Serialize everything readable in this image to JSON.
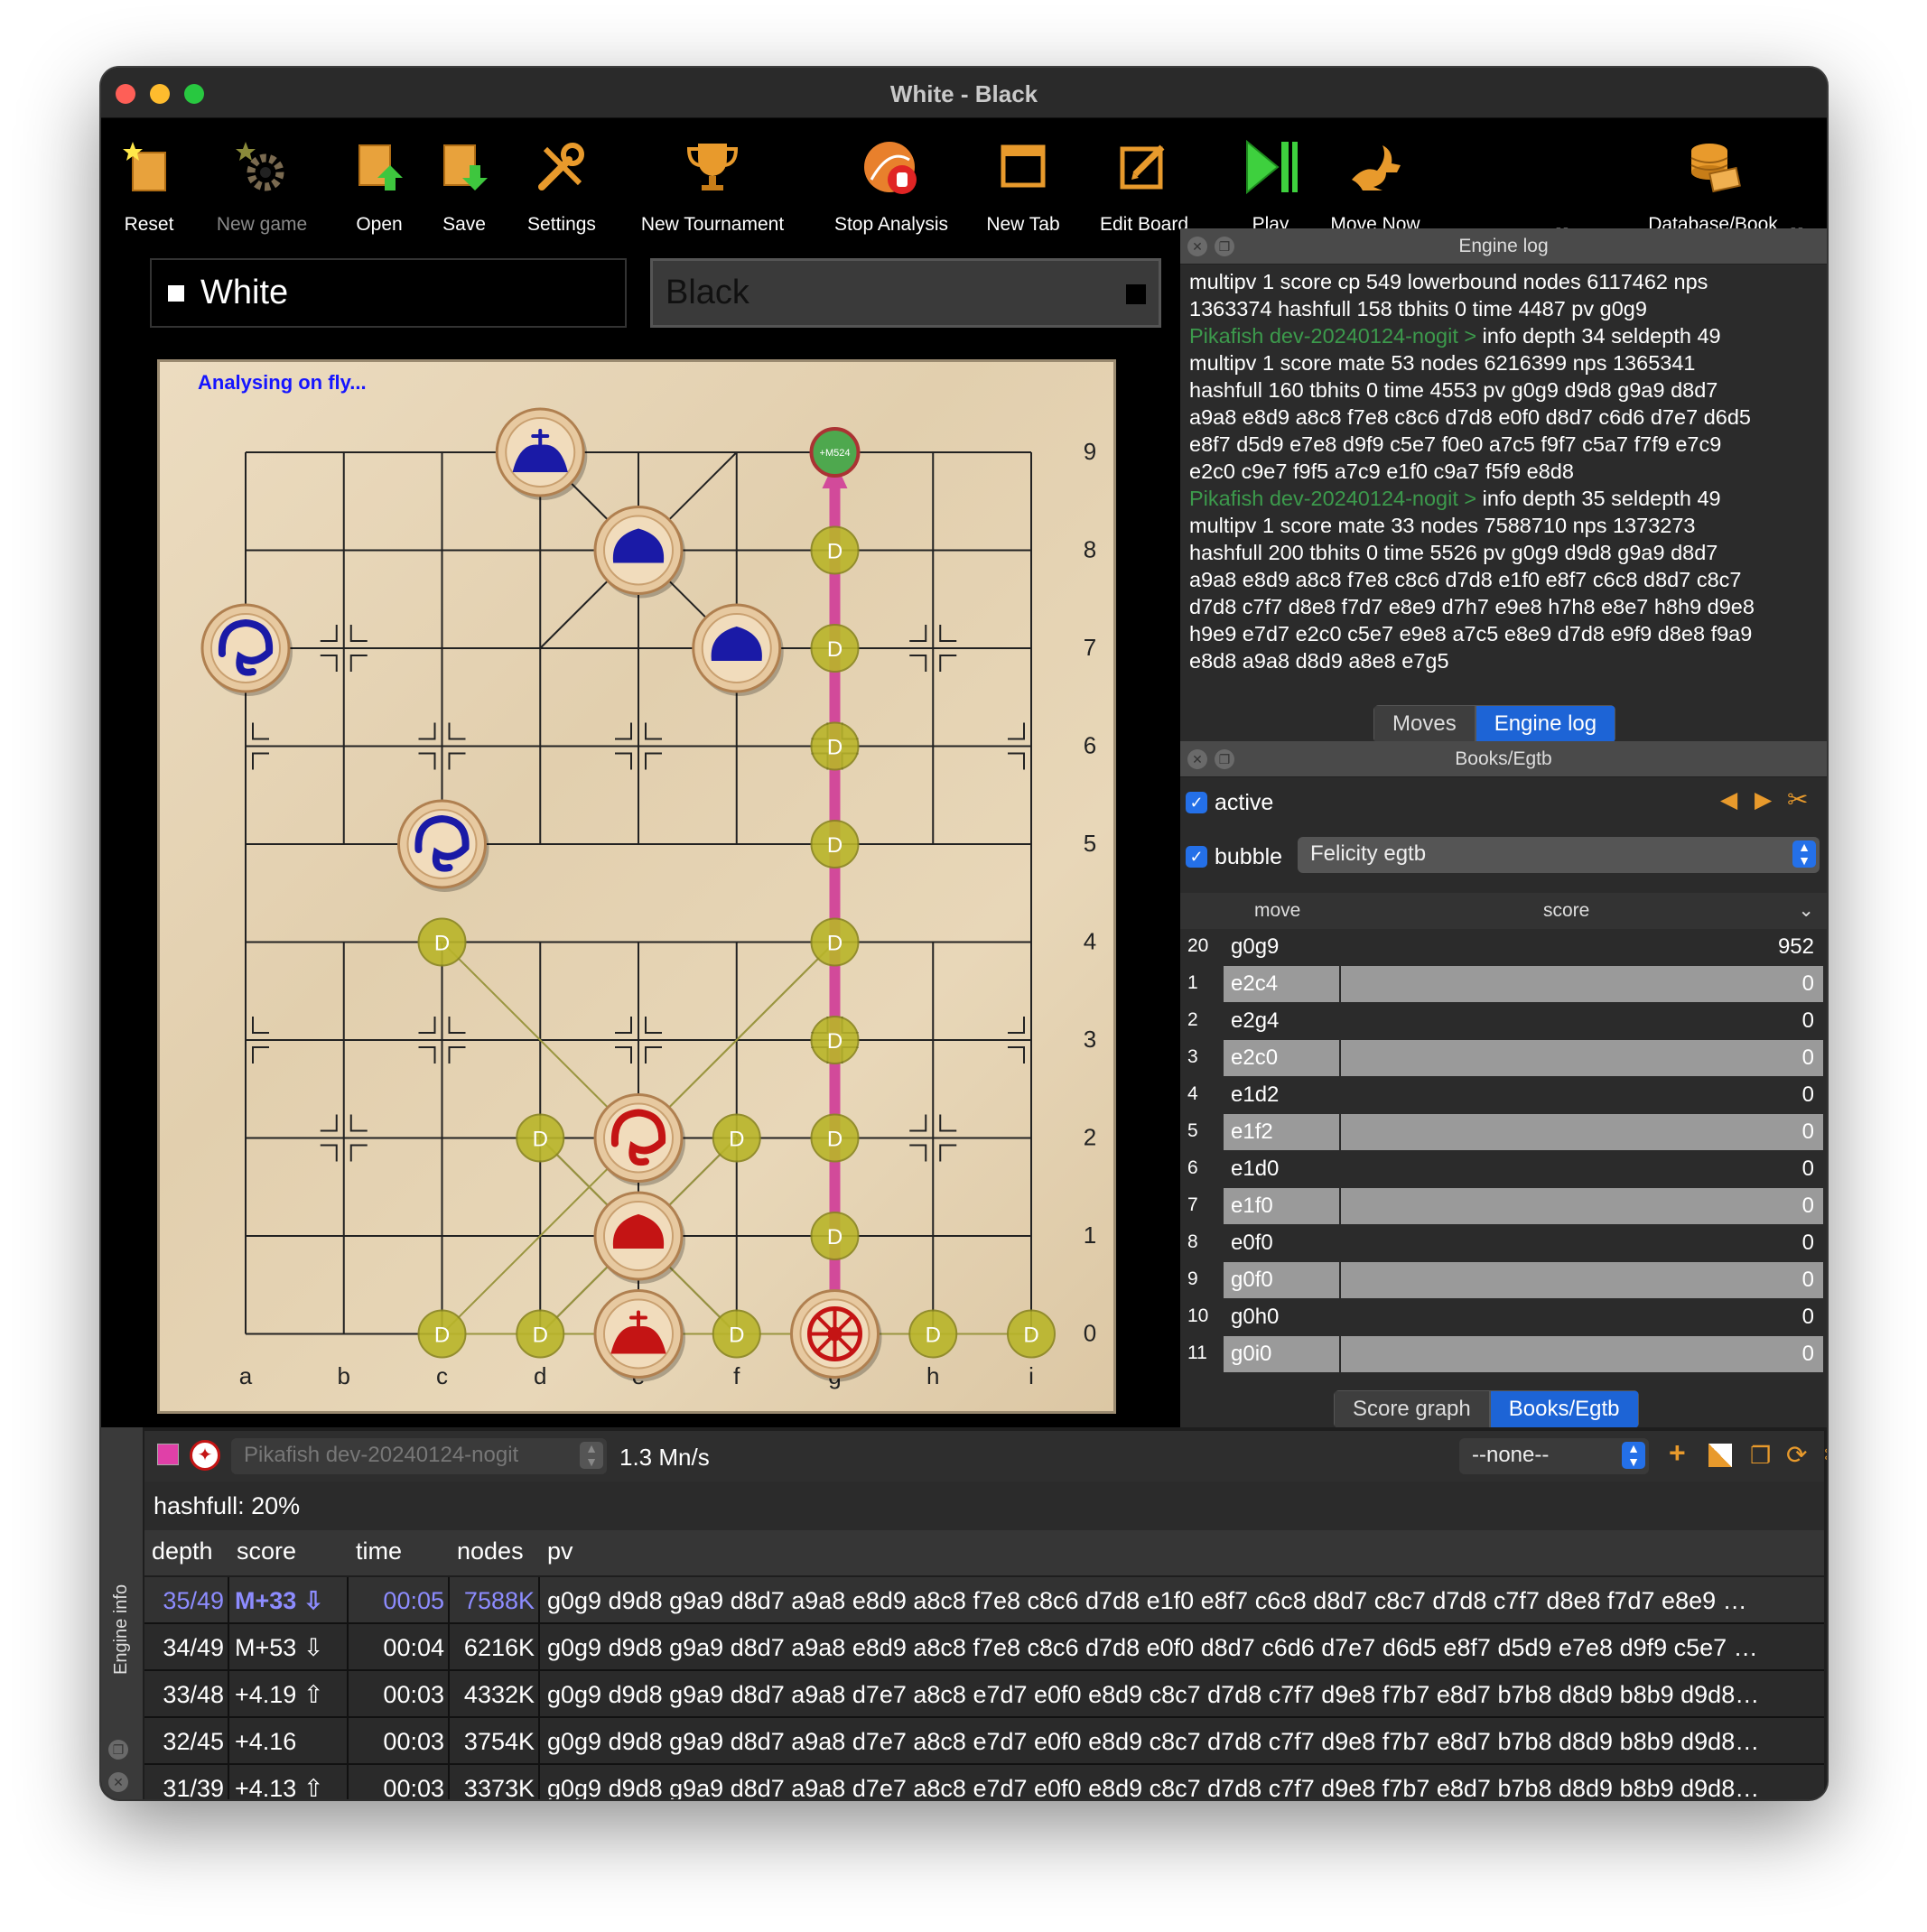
{
  "window": {
    "title": "White - Black"
  },
  "toolbar": [
    {
      "label": "Reset",
      "icon": "reset-icon",
      "enabled": true
    },
    {
      "label": "New game",
      "icon": "new-game-icon",
      "enabled": false
    },
    {
      "label": "Open",
      "icon": "open-icon",
      "enabled": true
    },
    {
      "label": "Save",
      "icon": "save-icon",
      "enabled": true
    },
    {
      "label": "Settings",
      "icon": "settings-icon",
      "enabled": true
    },
    {
      "label": "New Tournament",
      "icon": "trophy-icon",
      "enabled": true
    },
    {
      "label": "Stop Analysis",
      "icon": "stop-analysis-icon",
      "enabled": true
    },
    {
      "label": "New Tab",
      "icon": "new-tab-icon",
      "enabled": true
    },
    {
      "label": "Edit Board",
      "icon": "edit-board-icon",
      "enabled": true
    },
    {
      "label": "Play",
      "icon": "play-icon",
      "enabled": true
    },
    {
      "label": "Move Now",
      "icon": "move-now-icon",
      "enabled": true
    },
    {
      "label": "Database/Book",
      "icon": "database-icon",
      "enabled": true
    }
  ],
  "players": {
    "white": "White",
    "black": "Black"
  },
  "board": {
    "status": "Analysing on fly...",
    "files": [
      "a",
      "b",
      "c",
      "d",
      "e",
      "f",
      "g",
      "h",
      "i"
    ],
    "ranks": [
      "9",
      "8",
      "7",
      "6",
      "5",
      "4",
      "3",
      "2",
      "1",
      "0"
    ],
    "best_move_badge": "+M524",
    "hint_label": "D"
  },
  "engine_log": {
    "title": "Engine log",
    "lines": [
      {
        "engine": "",
        "text": "multipv 1 score cp 549 lowerbound nodes 6117462 nps"
      },
      {
        "engine": "",
        "text": "1363374 hashfull 158 tbhits 0 time 4487 pv g0g9"
      },
      {
        "engine": "Pikafish dev-20240124-nogit >",
        "text": " info depth 34 seldepth 49"
      },
      {
        "engine": "",
        "text": "multipv 1 score mate 53 nodes 6216399 nps 1365341"
      },
      {
        "engine": "",
        "text": "hashfull 160 tbhits 0 time 4553 pv g0g9 d9d8 g9a9 d8d7"
      },
      {
        "engine": "",
        "text": "a9a8 e8d9 a8c8 f7e8 c8c6 d7d8 e0f0 d8d7 c6d6 d7e7 d6d5"
      },
      {
        "engine": "",
        "text": "e8f7 d5d9 e7e8 d9f9 c5e7 f0e0 a7c5 f9f7 c5a7 f7f9 e7c9"
      },
      {
        "engine": "",
        "text": "e2c0 c9e7 f9f5 a7c9 e1f0 c9a7 f5f9 e8d8"
      },
      {
        "engine": "Pikafish dev-20240124-nogit >",
        "text": " info depth 35 seldepth 49"
      },
      {
        "engine": "",
        "text": "multipv 1 score mate 33 nodes 7588710 nps 1373273"
      },
      {
        "engine": "",
        "text": "hashfull 200 tbhits 0 time 5526 pv g0g9 d9d8 g9a9 d8d7"
      },
      {
        "engine": "",
        "text": "a9a8 e8d9 a8c8 f7e8 c8c6 d7d8 e1f0 e8f7 c6c8 d8d7 c8c7"
      },
      {
        "engine": "",
        "text": "d7d8 c7f7 d8e8 f7d7 e8e9 d7h7 e9e8 h7h8 e8e7 h8h9 d9e8"
      },
      {
        "engine": "",
        "text": "h9e9 e7d7 e2c0 c5e7 e9e8 a7c5 e8e9 d7d8 e9f9 d8e8 f9a9"
      },
      {
        "engine": "",
        "text": "e8d8 a9a8 d8d9 a8e8 e7g5"
      }
    ],
    "tabs": [
      "Moves",
      "Engine log"
    ]
  },
  "books": {
    "title": "Books/Egtb",
    "active_label": "active",
    "bubble_label": "bubble",
    "source": "Felicity egtb",
    "col_move": "move",
    "col_score": "score",
    "rows": [
      {
        "n": "20",
        "move": "g0g9",
        "score": "952"
      },
      {
        "n": "1",
        "move": "e2c4",
        "score": "0"
      },
      {
        "n": "2",
        "move": "e2g4",
        "score": "0"
      },
      {
        "n": "3",
        "move": "e2c0",
        "score": "0"
      },
      {
        "n": "4",
        "move": "e1d2",
        "score": "0"
      },
      {
        "n": "5",
        "move": "e1f2",
        "score": "0"
      },
      {
        "n": "6",
        "move": "e1d0",
        "score": "0"
      },
      {
        "n": "7",
        "move": "e1f0",
        "score": "0"
      },
      {
        "n": "8",
        "move": "e0f0",
        "score": "0"
      },
      {
        "n": "9",
        "move": "g0f0",
        "score": "0"
      },
      {
        "n": "10",
        "move": "g0h0",
        "score": "0"
      },
      {
        "n": "11",
        "move": "g0i0",
        "score": "0"
      }
    ],
    "tabs": [
      "Score graph",
      "Books/Egtb"
    ]
  },
  "engine_info": {
    "side_label": "Engine info",
    "engine": "Pikafish dev-20240124-nogit",
    "speed": "1.3 Mn/s",
    "book": "--none--",
    "hashfull": "hashfull: 20%",
    "headers": [
      "depth",
      "score",
      "time",
      "nodes",
      "pv"
    ],
    "rows": [
      {
        "depth": "35/49",
        "score": "M+33 ⇩",
        "time": "00:05",
        "nodes": "7588K",
        "pv": "g0g9 d9d8 g9a9 d8d7 a9a8 e8d9 a8c8 f7e8 c8c6 d7d8 e1f0 e8f7 c6c8 d8d7 c8c7 d7d8 c7f7 d8e8 f7d7 e8e9 …"
      },
      {
        "depth": "34/49",
        "score": "M+53 ⇩",
        "time": "00:04",
        "nodes": "6216K",
        "pv": "g0g9 d9d8 g9a9 d8d7 a9a8 e8d9 a8c8 f7e8 c8c6 d7d8 e0f0 d8d7 c6d6 d7e7 d6d5 e8f7 d5d9 e7e8 d9f9 c5e7 …"
      },
      {
        "depth": "33/48",
        "score": "+4.19 ⇧",
        "time": "00:03",
        "nodes": "4332K",
        "pv": "g0g9 d9d8 g9a9 d8d7 a9a8 d7e7 a8c8 e7d7 e0f0 e8d9 c8c7 d7d8 c7f7 d9e8 f7b7 e8d7 b7b8 d8d9 b8b9 d9d8…"
      },
      {
        "depth": "32/45",
        "score": "+4.16",
        "time": "00:03",
        "nodes": "3754K",
        "pv": "g0g9 d9d8 g9a9 d8d7 a9a8 d7e7 a8c8 e7d7 e0f0 e8d9 c8c7 d7d8 c7f7 d9e8 f7b7 e8d7 b7b8 d8d9 b8b9 d9d8…"
      },
      {
        "depth": "31/39",
        "score": "+4.13 ⇧",
        "time": "00:03",
        "nodes": "3373K",
        "pv": "g0g9 d9d8 g9a9 d8d7 a9a8 d7e7 a8c8 e7d7 e0f0 e8d9 c8c7 d7d8 c7f7 d9e8 f7b7 e8d7 b7b8 d8d9 b8b9 d9d8…"
      }
    ]
  },
  "colors": {
    "accent": "#1d64d6",
    "log_engine": "#3c9a4c",
    "arrow": "#d24a9a",
    "hint": "#b9b52a",
    "red_piece": "#c41414",
    "blue_piece": "#1a1aa6",
    "highlight_row": "#8d8cff"
  }
}
